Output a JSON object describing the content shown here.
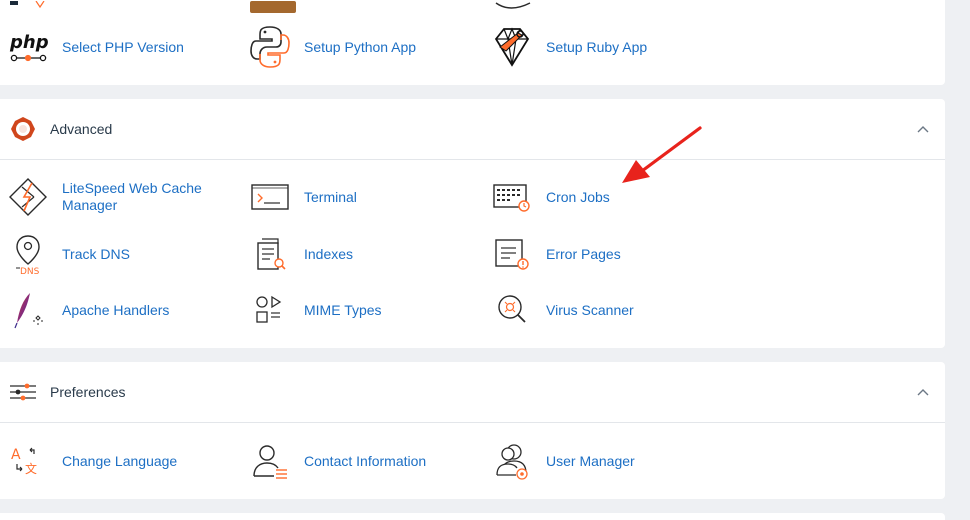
{
  "software": {
    "items": [
      {
        "label": "Select PHP Version",
        "icon": "php-icon"
      },
      {
        "label": "Setup Python App",
        "icon": "python-icon"
      },
      {
        "label": "Setup Ruby App",
        "icon": "ruby-icon"
      }
    ]
  },
  "advanced": {
    "title": "Advanced",
    "items": [
      {
        "label": "LiteSpeed Web Cache Manager",
        "icon": "litespeed-icon"
      },
      {
        "label": "Terminal",
        "icon": "terminal-icon"
      },
      {
        "label": "Cron Jobs",
        "icon": "cron-jobs-icon"
      },
      {
        "label": "Track DNS",
        "icon": "track-dns-icon"
      },
      {
        "label": "Indexes",
        "icon": "indexes-icon"
      },
      {
        "label": "Error Pages",
        "icon": "error-pages-icon"
      },
      {
        "label": "Apache Handlers",
        "icon": "apache-feather-icon"
      },
      {
        "label": "MIME Types",
        "icon": "mime-types-icon"
      },
      {
        "label": "Virus Scanner",
        "icon": "virus-scanner-icon"
      }
    ]
  },
  "preferences": {
    "title": "Preferences",
    "items": [
      {
        "label": "Change Language",
        "icon": "language-icon"
      },
      {
        "label": "Contact Information",
        "icon": "contact-icon"
      },
      {
        "label": "User Manager",
        "icon": "user-manager-icon"
      }
    ]
  },
  "colors": {
    "link": "#1d6fc4",
    "accent": "#ff6c2c",
    "annotation_arrow": "#e8231c"
  }
}
